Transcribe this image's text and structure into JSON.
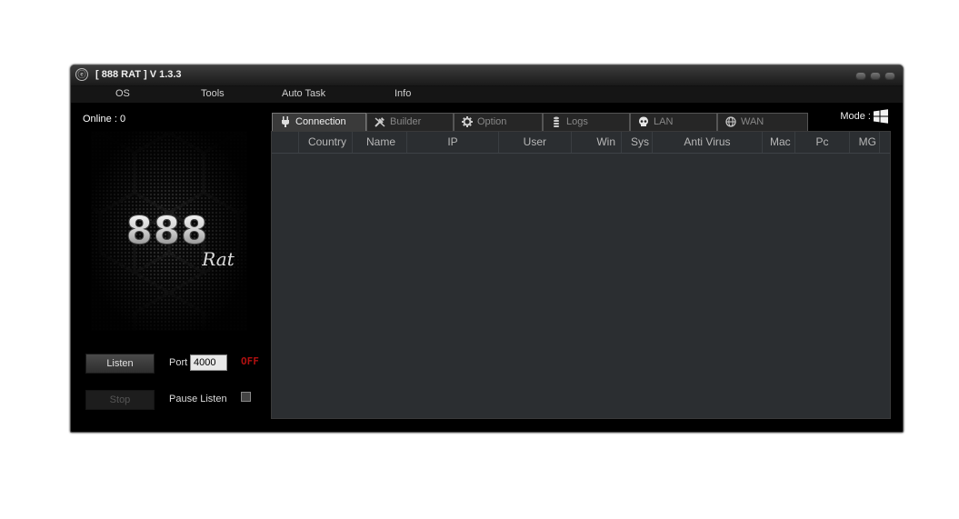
{
  "window": {
    "title": "[ 888 RAT ] V 1.3.3",
    "app_icon_glyph": "ⓔ"
  },
  "menu": {
    "items": [
      "OS",
      "Tools",
      "Auto Task",
      "Info"
    ]
  },
  "left_panel": {
    "online_label": "Online : 0",
    "logo_text": "888",
    "logo_script": "Rat",
    "listen_button": "Listen",
    "stop_button": "Stop",
    "port_label": "Port",
    "port_value": "4000",
    "status": "OFF",
    "pause_label": "Pause Listen",
    "pause_checked": false
  },
  "tabs": [
    {
      "label": "Connection",
      "icon": "plug-icon",
      "active": true
    },
    {
      "label": "Builder",
      "icon": "tools-icon",
      "active": false
    },
    {
      "label": "Option",
      "icon": "gear-icon",
      "active": false
    },
    {
      "label": "Logs",
      "icon": "database-icon",
      "active": false
    },
    {
      "label": "LAN",
      "icon": "skull-icon",
      "active": false
    },
    {
      "label": "WAN",
      "icon": "globe-icon",
      "active": false
    }
  ],
  "mode": {
    "label": "Mode :",
    "icon": "windows-logo-icon"
  },
  "table": {
    "columns": [
      "Country",
      "Name",
      "IP",
      "User",
      "Win",
      "Sys",
      "Anti Virus",
      "Mac",
      "Pc",
      "MG"
    ],
    "rows": []
  },
  "colors": {
    "status_off": "#b01010",
    "grid_bg": "#2b2e31",
    "window_bg": "#000000"
  }
}
